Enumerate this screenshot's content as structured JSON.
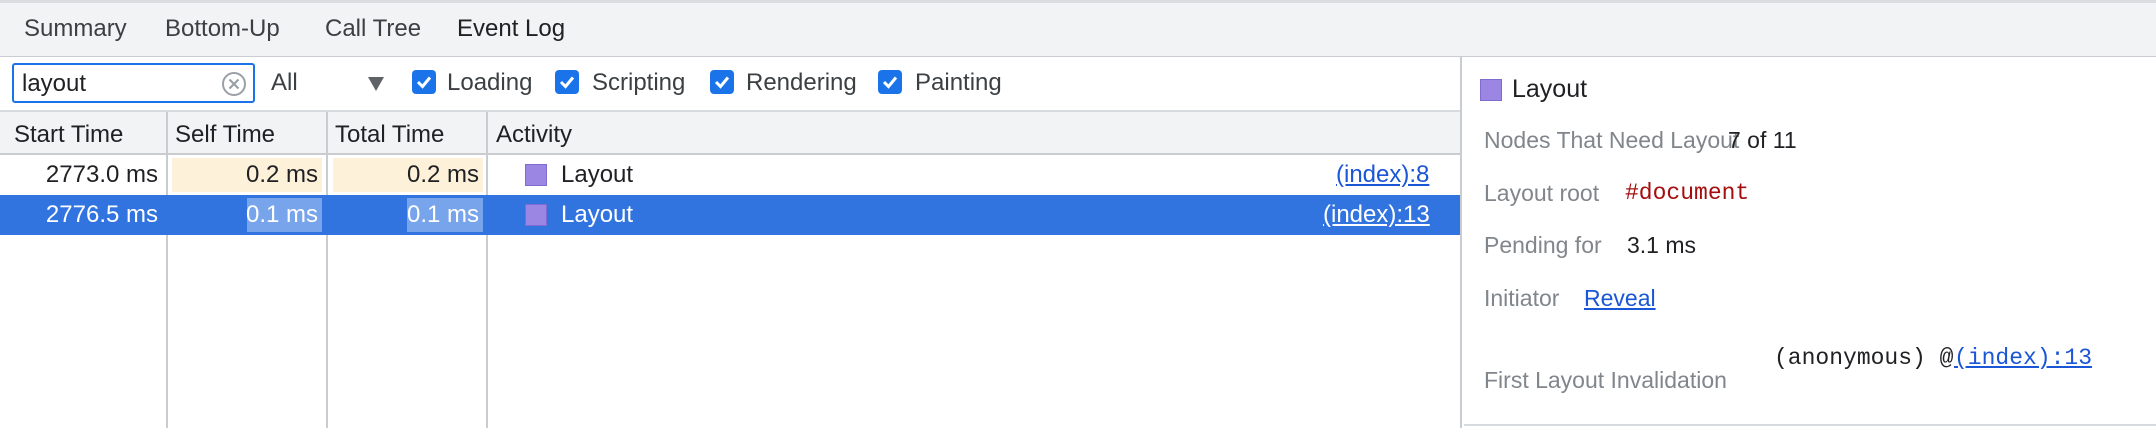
{
  "tabs": [
    {
      "label": "Summary"
    },
    {
      "label": "Bottom-Up"
    },
    {
      "label": "Call Tree"
    },
    {
      "label": "Event Log"
    }
  ],
  "filter": {
    "search_value": "layout",
    "category_select": "All",
    "checkboxes": [
      {
        "label": "Loading",
        "checked": true
      },
      {
        "label": "Scripting",
        "checked": true
      },
      {
        "label": "Rendering",
        "checked": true
      },
      {
        "label": "Painting",
        "checked": true
      }
    ]
  },
  "table": {
    "columns": [
      "Start Time",
      "Self Time",
      "Total Time",
      "Activity"
    ],
    "rows": [
      {
        "start": "2773.0 ms",
        "self": "0.2 ms",
        "total": "0.2 ms",
        "activity": "Layout",
        "source": "(index):8",
        "selected": false
      },
      {
        "start": "2776.5 ms",
        "self": "0.1 ms",
        "total": "0.1 ms",
        "activity": "Layout",
        "source": "(index):13",
        "selected": true
      }
    ]
  },
  "details": {
    "title": "Layout",
    "nodes_label": "Nodes That Need Layout",
    "nodes_value": "7 of 11",
    "root_label": "Layout root",
    "root_value": "#document",
    "pending_label": "Pending for",
    "pending_value": "3.1 ms",
    "initiator_label": "Initiator",
    "initiator_link": "Reveal",
    "invalidation_label": "First Layout Invalidation",
    "invalidation_fn": "(anonymous) @",
    "invalidation_link": "(index):13"
  },
  "colors": {
    "accent": "#1a73e8",
    "selected_row": "#3174e0",
    "layout_swatch": "#9b87e3",
    "self_time_bar": "#fdf2d9",
    "root_value": "#a50e0e"
  }
}
